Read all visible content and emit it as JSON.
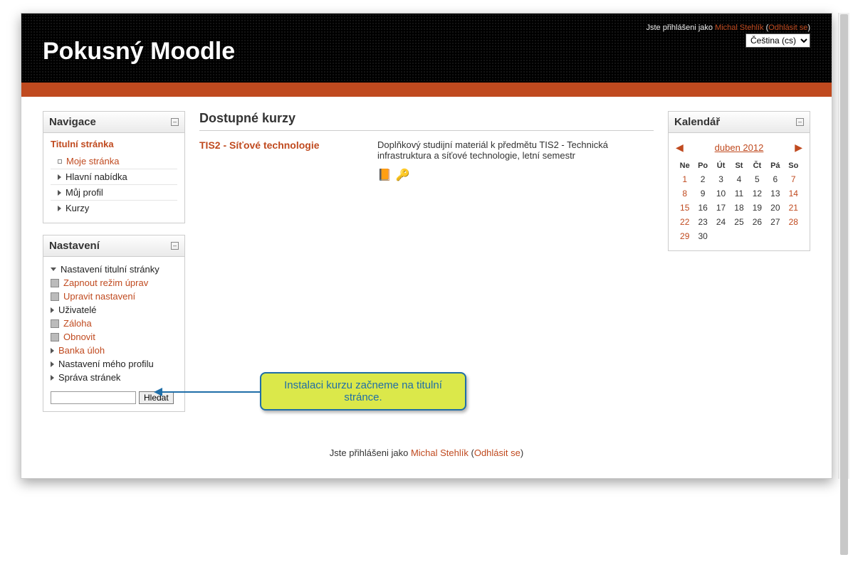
{
  "header": {
    "login_prefix": "Jste přihlášeni jako ",
    "user_name": "Michal Stehlík",
    "logout_label": "Odhlásit se",
    "title": "Pokusný Moodle",
    "language_selected": "Čeština (cs)"
  },
  "navigation": {
    "block_title": "Navigace",
    "root_label": "Titulní stránka",
    "items": [
      {
        "label": "Moje stránka",
        "link": true
      },
      {
        "label": "Hlavní nabídka",
        "link": false
      },
      {
        "label": "Můj profil",
        "link": false
      },
      {
        "label": "Kurzy",
        "link": false
      }
    ]
  },
  "settings": {
    "block_title": "Nastavení",
    "front_page": {
      "label": "Nastavení titulní stránky",
      "items": [
        {
          "label": "Zapnout režim úprav",
          "icon": "edit"
        },
        {
          "label": "Upravit nastavení",
          "icon": "settings"
        },
        {
          "label": "Uživatelé",
          "icon": "caret",
          "black": true
        },
        {
          "label": "Záloha",
          "icon": "backup"
        },
        {
          "label": "Obnovit",
          "icon": "restore"
        },
        {
          "label": "Banka úloh",
          "icon": "caret"
        }
      ]
    },
    "profile_label": "Nastavení mého profilu",
    "admin_label": "Správa stránek",
    "search_button": "Hledat"
  },
  "main": {
    "heading": "Dostupné kurzy",
    "course": {
      "title": "TIS2 - Síťové technologie",
      "description": "Doplňkový studijní materiál k předmětu TIS2 - Technická infrastruktura a síťové technologie, letní semestr"
    }
  },
  "calendar": {
    "block_title": "Kalendář",
    "month_label": "duben 2012",
    "day_headers": [
      "Ne",
      "Po",
      "Út",
      "St",
      "Čt",
      "Pá",
      "So"
    ],
    "weeks": [
      [
        "1",
        "2",
        "3",
        "4",
        "5",
        "6",
        "7"
      ],
      [
        "8",
        "9",
        "10",
        "11",
        "12",
        "13",
        "14"
      ],
      [
        "15",
        "16",
        "17",
        "18",
        "19",
        "20",
        "21"
      ],
      [
        "22",
        "23",
        "24",
        "25",
        "26",
        "27",
        "28"
      ],
      [
        "29",
        "30",
        "",
        "",
        "",
        "",
        ""
      ]
    ]
  },
  "footer": {
    "login_prefix": "Jste přihlášeni jako ",
    "user_name": "Michal Stehlík",
    "logout_label": "Odhlásit se"
  },
  "annotation": {
    "text": "Instalaci kurzu začneme na titulní stránce."
  }
}
